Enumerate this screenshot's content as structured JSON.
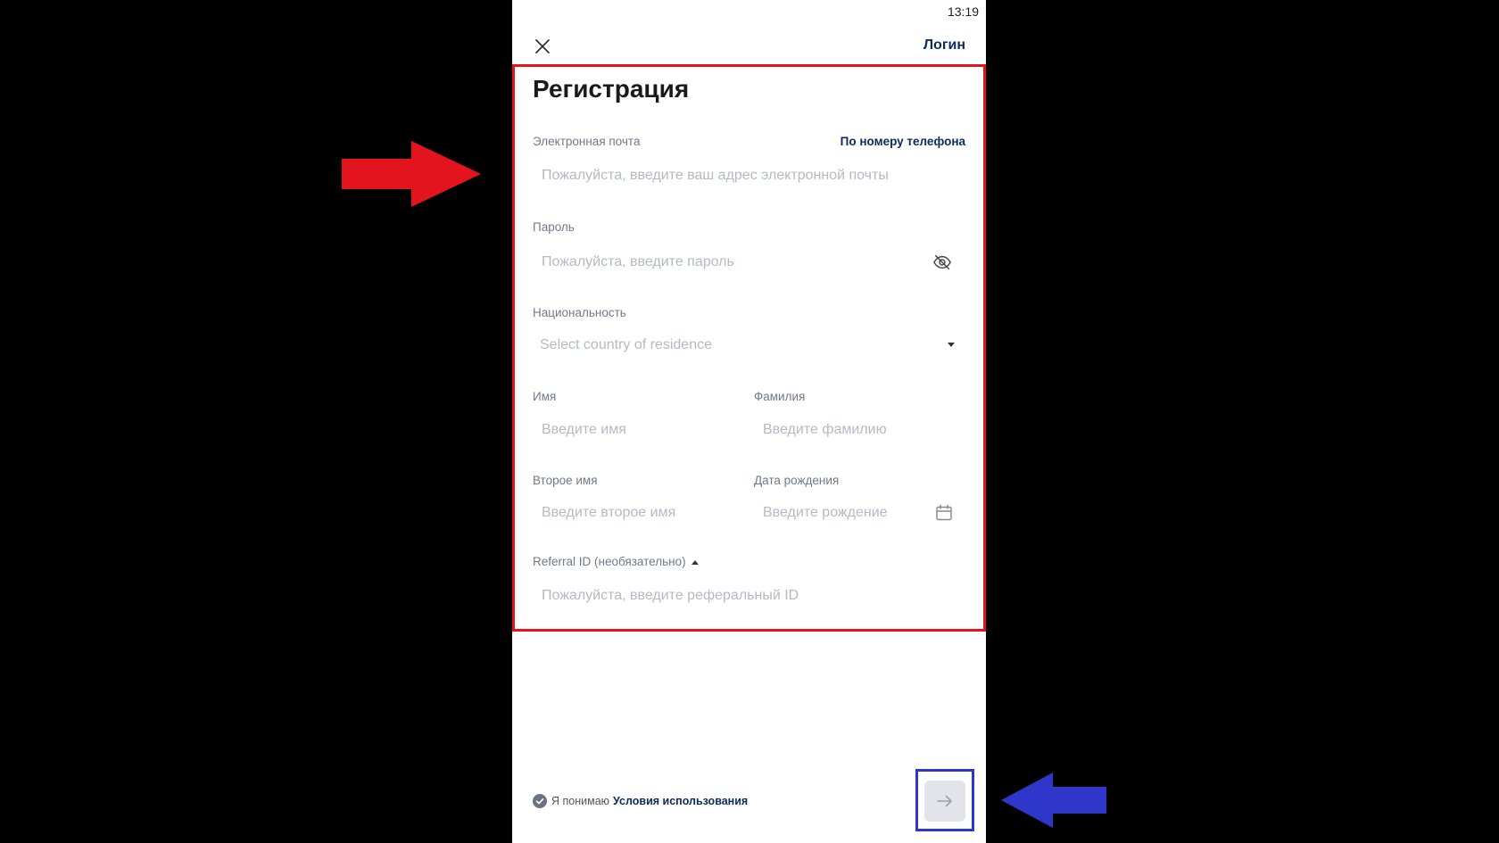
{
  "status_bar": {
    "time": "13:19"
  },
  "header": {
    "login_label": "Логин"
  },
  "form": {
    "title": "Регистрация",
    "email": {
      "label": "Электронная почта",
      "switch_label": "По номеру телефона",
      "placeholder": "Пожалуйста, введите ваш адрес электронной почты"
    },
    "password": {
      "label": "Пароль",
      "placeholder": "Пожалуйста, введите пароль"
    },
    "nationality": {
      "label": "Национальность",
      "placeholder": "Select country of residence"
    },
    "first_name": {
      "label": "Имя",
      "placeholder": "Введите имя"
    },
    "last_name": {
      "label": "Фамилия",
      "placeholder": "Введите фамилию"
    },
    "middle_name": {
      "label": "Второе имя",
      "placeholder": "Введите второе имя"
    },
    "birth_date": {
      "label": "Дата рождения",
      "placeholder": "Введите рождение"
    },
    "referral": {
      "label": "Referral ID (необязательно)",
      "placeholder": "Пожалуйста, введите реферальный ID"
    }
  },
  "footer": {
    "terms_prefix": "Я понимаю",
    "terms_link": "Условия использования",
    "checked": true
  },
  "icons": {
    "close": "close-icon",
    "password_visibility": "eye-off-icon",
    "dropdown": "caret-down-icon",
    "calendar": "calendar-icon",
    "referral_toggle": "caret-up-icon",
    "terms_check": "check-circle-icon",
    "next": "arrow-right-icon"
  },
  "colors": {
    "accent": "#0d2a5c",
    "annotation_red": "#e4141f",
    "annotation_blue": "#2e37c9",
    "button_disabled": "#e2e4ea",
    "placeholder": "#b4b9c3",
    "label": "#707a8a"
  }
}
